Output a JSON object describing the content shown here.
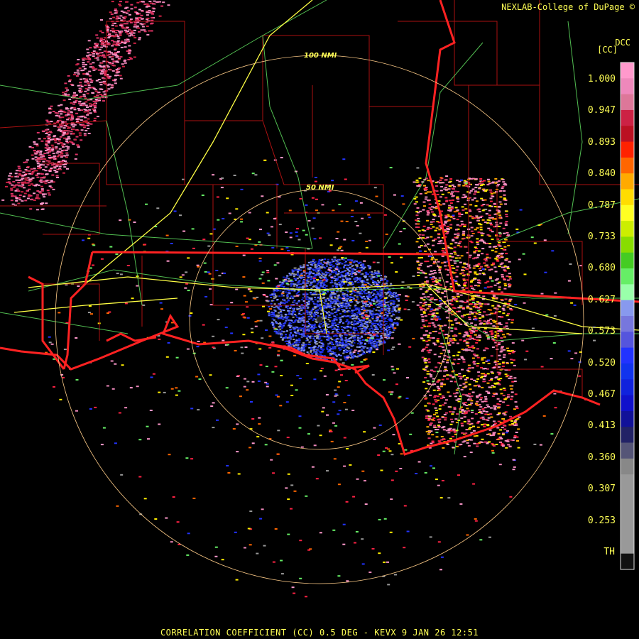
{
  "header": {
    "credit": "NEXLAB-College of DuPage ©",
    "site_code": "DCC",
    "units": "[CC]"
  },
  "range_rings": [
    {
      "label": "50 NMI",
      "radius_nmi": 50
    },
    {
      "label": "100 NMI",
      "radius_nmi": 100
    }
  ],
  "legend": {
    "ticks": [
      "1.000",
      "0.947",
      "0.893",
      "0.840",
      "0.787",
      "0.733",
      "0.680",
      "0.627",
      "0.573",
      "0.520",
      "0.467",
      "0.413",
      "0.360",
      "0.307",
      "0.253",
      "TH"
    ],
    "colors": [
      "#ff99cc",
      "#ee88bb",
      "#dd7799",
      "#cc2244",
      "#bb1122",
      "#ff2200",
      "#ff6600",
      "#ffaa00",
      "#ffdd00",
      "#ffff22",
      "#ccee00",
      "#88dd00",
      "#44cc22",
      "#66ee66",
      "#99ffaa",
      "#8899ee",
      "#7777dd",
      "#5555dd",
      "#2233ff",
      "#1133ee",
      "#1122dd",
      "#1111cc",
      "#111199",
      "#222266",
      "#555577",
      "#888888",
      "#999999",
      "#999999",
      "#999999",
      "#999999",
      "#999999",
      "#111111"
    ]
  },
  "footer": {
    "product": "CORRELATION COEFFICIENT (CC)",
    "tilt": "0.5 DEG",
    "site": "KEVX",
    "datetime": "9 JAN 26 12:51",
    "separator": "-"
  },
  "colors": {
    "text": "#ffff55",
    "state_border": "#ff2222",
    "county_border": "#aa1111",
    "highway": "#ffff44",
    "road": "#66ee66",
    "ring": "#ffcc88"
  }
}
